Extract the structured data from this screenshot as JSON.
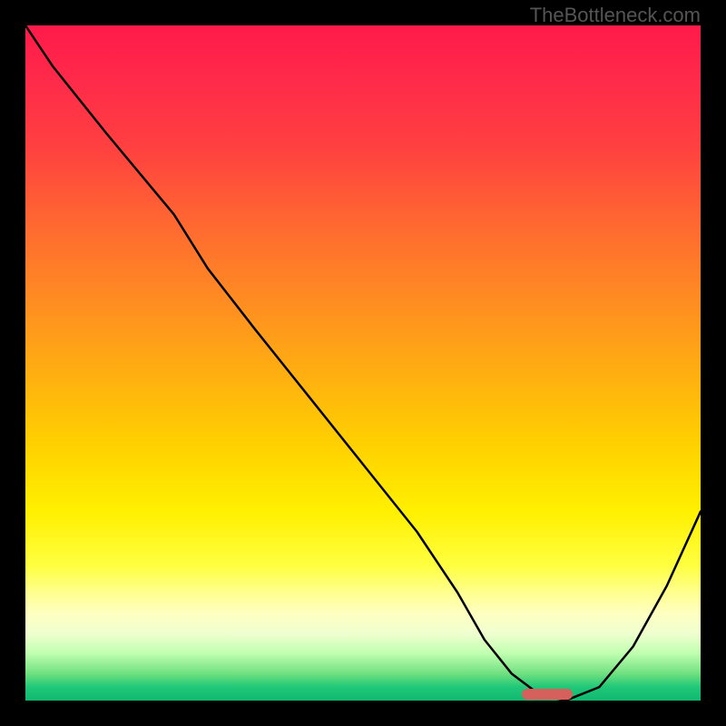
{
  "watermark": "TheBottleneck.com",
  "chart_data": {
    "type": "line",
    "title": "",
    "xlabel": "",
    "ylabel": "",
    "xlim": [
      0,
      100
    ],
    "ylim": [
      0,
      100
    ],
    "series": [
      {
        "name": "curve",
        "x": [
          0,
          4,
          8,
          12,
          17,
          22,
          27,
          34,
          42,
          50,
          58,
          64,
          68,
          72,
          76,
          80,
          85,
          90,
          95,
          100
        ],
        "values": [
          100,
          94,
          89,
          84,
          78,
          72,
          64,
          55,
          45,
          35,
          25,
          16,
          9,
          4,
          1,
          0,
          2,
          8,
          17,
          28
        ]
      }
    ],
    "marker": {
      "x_start": 73.5,
      "x_end": 81,
      "y": 1.0
    },
    "background_bands": [
      {
        "from": 0,
        "to": 86,
        "label": "red-yellow-gradient"
      },
      {
        "from": 86,
        "to": 100,
        "label": "green"
      }
    ]
  }
}
